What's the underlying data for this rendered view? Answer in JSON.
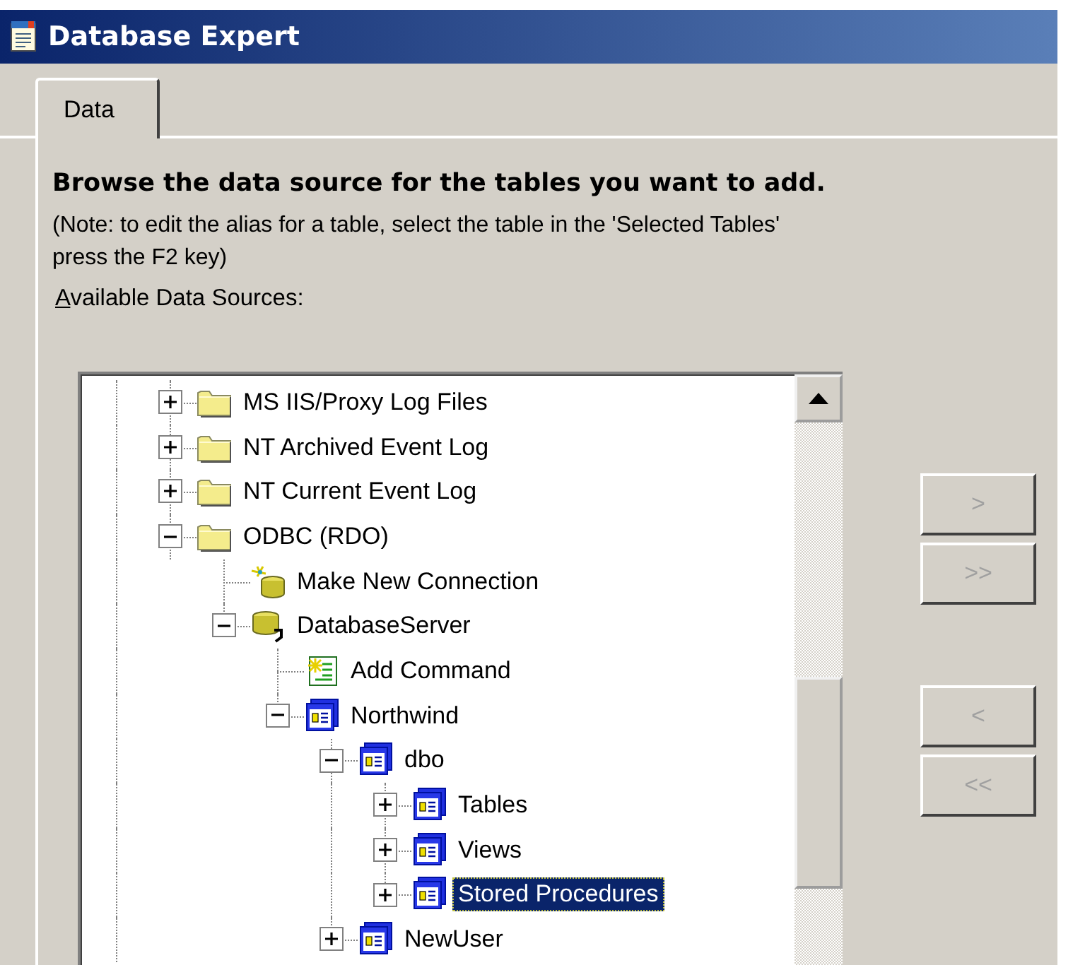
{
  "window": {
    "title": "Database Expert"
  },
  "tabs": [
    {
      "label": "Data",
      "selected": true
    }
  ],
  "heading": "Browse the data source for the tables you want to add.",
  "note": "(Note: to edit the alias for a table, select the table in the 'Selected Tables'",
  "note_line2": "press the F2 key)",
  "sources_label": "Available Data Sources:",
  "tree": {
    "items": [
      {
        "kind": "folder",
        "label": "MS IIS/Proxy Log Files",
        "expanded": false,
        "selected": false
      },
      {
        "kind": "folder",
        "label": "NT Archived Event Log",
        "expanded": false,
        "selected": false
      },
      {
        "kind": "folder",
        "label": "NT Current Event Log",
        "expanded": false,
        "selected": false
      },
      {
        "kind": "folder",
        "label": "ODBC (RDO)",
        "expanded": true,
        "selected": false,
        "children": [
          {
            "kind": "wizard",
            "label": "Make New Connection",
            "selected": false
          },
          {
            "kind": "server",
            "label": "DatabaseServer",
            "expanded": true,
            "selected": false,
            "children": [
              {
                "kind": "command",
                "label": "Add Command",
                "selected": false
              },
              {
                "kind": "database",
                "label": "Northwind",
                "expanded": true,
                "selected": false,
                "children": [
                  {
                    "kind": "database",
                    "label": "dbo",
                    "expanded": true,
                    "selected": false,
                    "children": [
                      {
                        "kind": "database",
                        "label": "Tables",
                        "expanded": false,
                        "selected": false
                      },
                      {
                        "kind": "database",
                        "label": "Views",
                        "expanded": false,
                        "selected": false
                      },
                      {
                        "kind": "database",
                        "label": "Stored Procedures",
                        "expanded": false,
                        "selected": true
                      }
                    ]
                  },
                  {
                    "kind": "database",
                    "label": "NewUser",
                    "expanded": false,
                    "selected": false
                  }
                ]
              }
            ]
          }
        ]
      }
    ]
  },
  "buttons": [
    {
      "label": ">",
      "disabled": true
    },
    {
      "label": ">>",
      "disabled": true
    },
    {
      "label": "<",
      "disabled": true
    },
    {
      "label": "<<",
      "disabled": true
    }
  ]
}
